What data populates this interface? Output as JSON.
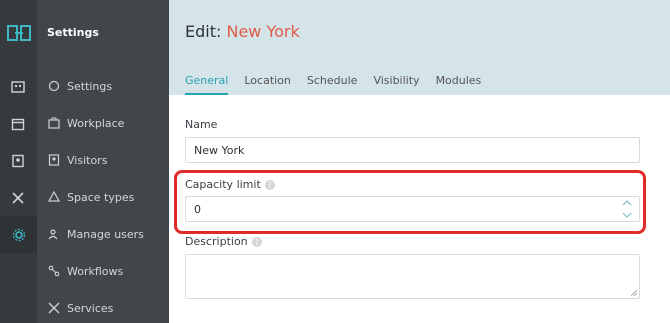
{
  "app": {
    "section_title": "Settings"
  },
  "sidebar": {
    "items": [
      {
        "label": "Settings",
        "icon": "gear-outline-icon"
      },
      {
        "label": "Workplace",
        "icon": "briefcase-icon"
      },
      {
        "label": "Visitors",
        "icon": "id-badge-icon"
      },
      {
        "label": "Space types",
        "icon": "shapes-icon"
      },
      {
        "label": "Manage users",
        "icon": "users-icon"
      },
      {
        "label": "Workflows",
        "icon": "workflow-icon"
      },
      {
        "label": "Services",
        "icon": "tools-icon"
      }
    ]
  },
  "page": {
    "title_prefix": "Edit:",
    "title_name": "New York",
    "tabs": [
      "General",
      "Location",
      "Schedule",
      "Visibility",
      "Modules"
    ],
    "active_tab": "General"
  },
  "form": {
    "name_label": "Name",
    "name_value": "New York",
    "capacity_label": "Capacity limit",
    "capacity_value": "0",
    "description_label": "Description",
    "help_glyph": "?"
  },
  "colors": {
    "accent": "#2aa3b3",
    "title_name": "#e05b4b",
    "highlight": "#e02b2b"
  }
}
